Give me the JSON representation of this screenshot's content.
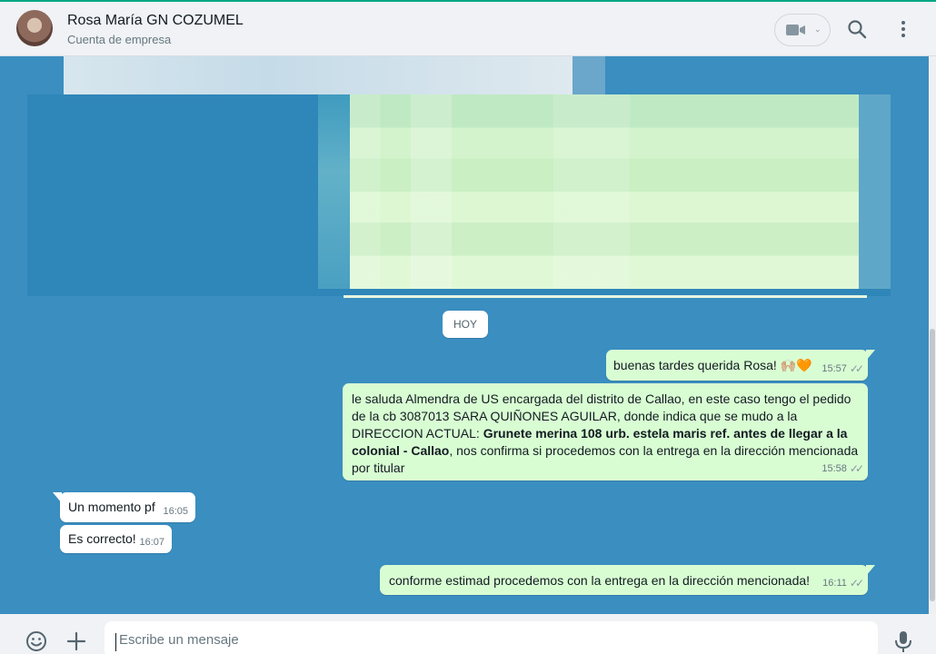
{
  "header": {
    "contact_name": "Rosa María GN COZUMEL",
    "contact_subtitle": "Cuenta de empresa"
  },
  "chat": {
    "day_label": "HOY",
    "messages": [
      {
        "direction": "out",
        "text": "buenas tardes querida Rosa! 🙌🏼🧡",
        "time": "15:57",
        "status": "read"
      },
      {
        "direction": "out",
        "text_parts": [
          "le saluda Almendra de US encargada del distrito de Callao, en este caso tengo el pedido de la  cb 3087013 SARA QUIÑONES AGUILAR, donde indica que se mudo a la DIRECCION ACTUAL: ",
          "Grunete merina 108  urb. estela maris ref. antes de llegar a la colonial - Callao",
          ", nos confirma si procedemos con la entrega en la dirección mencionada por titular"
        ],
        "time": "15:58",
        "status": "read"
      },
      {
        "direction": "in",
        "text": "Un momento pf",
        "time": "16:05"
      },
      {
        "direction": "in",
        "text": "Es correcto!",
        "time": "16:07"
      },
      {
        "direction": "out",
        "text": "conforme estimad procedemos con la entrega en la dirección mencionada!",
        "time": "16:11",
        "status": "read"
      }
    ]
  },
  "composer": {
    "placeholder": "Escribe un mensaje"
  },
  "icons": [
    "video-call-icon",
    "chevron-down-icon",
    "search-icon",
    "menu-icon",
    "emoji-icon",
    "attach-plus-icon",
    "microphone-icon",
    "double-check-icon"
  ],
  "colors": {
    "accent": "#00a884",
    "chat_background": "#3a8ec0",
    "outgoing_bubble": "#d9fdd3",
    "incoming_bubble": "#ffffff"
  }
}
